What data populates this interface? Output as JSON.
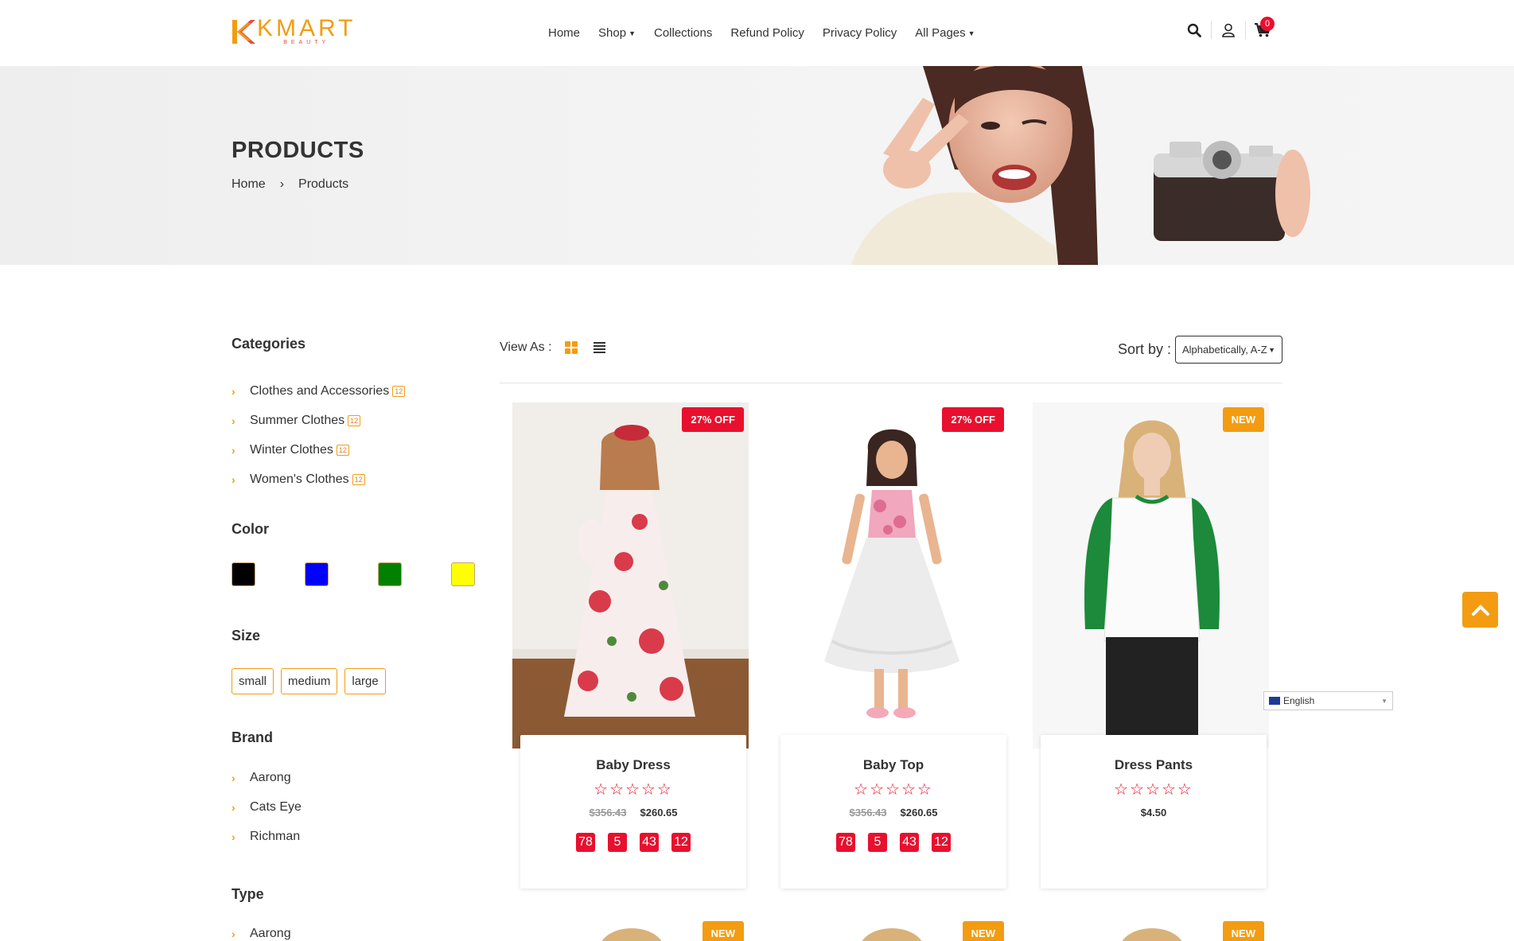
{
  "logo": {
    "word": "KMART",
    "sub": "BEAUTY"
  },
  "nav": [
    {
      "label": "Home",
      "dropdown": false
    },
    {
      "label": "Shop",
      "dropdown": true
    },
    {
      "label": "Collections",
      "dropdown": false
    },
    {
      "label": "Refund Policy",
      "dropdown": false
    },
    {
      "label": "Privacy Policy",
      "dropdown": false
    },
    {
      "label": "All Pages",
      "dropdown": true
    }
  ],
  "cart_count": "0",
  "banner": {
    "title": "PRODUCTS",
    "breadcrumb_home": "Home",
    "breadcrumb_sep": "›",
    "breadcrumb_current": "Products"
  },
  "sidebar": {
    "categories_title": "Categories",
    "categories": [
      {
        "label": "Clothes and Accessories",
        "count": "12"
      },
      {
        "label": "Summer Clothes",
        "count": "12"
      },
      {
        "label": "Winter Clothes",
        "count": "12"
      },
      {
        "label": "Women's Clothes",
        "count": "12"
      }
    ],
    "color_title": "Color",
    "colors": [
      "#000000",
      "#0000ff",
      "#008000",
      "#ffff00"
    ],
    "size_title": "Size",
    "sizes": [
      "small",
      "medium",
      "large"
    ],
    "brand_title": "Brand",
    "brands": [
      "Aarong",
      "Cats Eye",
      "Richman"
    ],
    "type_title": "Type",
    "types": [
      "Aarong"
    ]
  },
  "toolbar": {
    "view_as": "View As :",
    "sort_label": "Sort by :",
    "sort_value": "Alphabetically, A-Z"
  },
  "products": [
    {
      "name": "Baby Dress",
      "badge": "27% OFF",
      "badge_type": "off",
      "old_price": "$356.43",
      "price": "$260.65",
      "countdown": [
        "78",
        "5",
        "43",
        "12"
      ],
      "rating": 0
    },
    {
      "name": "Baby Top",
      "badge": "27% OFF",
      "badge_type": "off",
      "old_price": "$356.43",
      "price": "$260.65",
      "countdown": [
        "78",
        "5",
        "43",
        "12"
      ],
      "rating": 0
    },
    {
      "name": "Dress Pants",
      "badge": "NEW",
      "badge_type": "new",
      "old_price": "",
      "price": "$4.50",
      "countdown": [],
      "rating": 0
    }
  ],
  "next_row_badges": [
    "NEW",
    "NEW",
    "NEW"
  ],
  "language": "English",
  "colors_ui": {
    "accent": "#f39c12",
    "sale": "#e8102e"
  }
}
